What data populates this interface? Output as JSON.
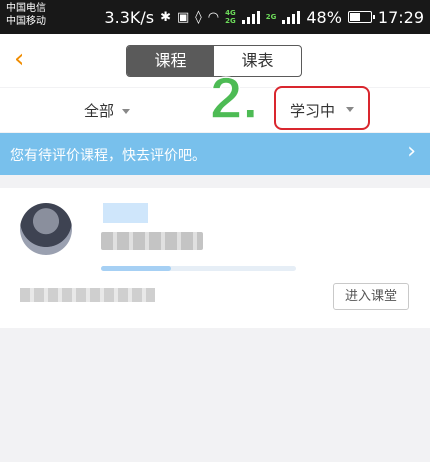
{
  "status_bar": {
    "carrier_1": "中国电信",
    "carrier_2": "中国移动",
    "speed": "3.3K/s",
    "battery": "48%",
    "battery_level": 0.48,
    "time": "17:29"
  },
  "header": {
    "back_icon": "chevron-left-icon",
    "tabs": [
      {
        "label": "课程",
        "active": true
      },
      {
        "label": "课表",
        "active": false
      }
    ]
  },
  "filter": {
    "scope": "全部",
    "status": "学习中"
  },
  "annotation": {
    "step_label": "2."
  },
  "banner": {
    "text": "您有待评价课程，快去评价吧。",
    "arrow": "›"
  },
  "course_card": {
    "progress": 0.36,
    "enter_label": "进入课堂"
  },
  "colors": {
    "accent": "#f08c00",
    "banner": "#78c0ec",
    "highlight": "#d9262e",
    "step": "#4dbb54"
  }
}
